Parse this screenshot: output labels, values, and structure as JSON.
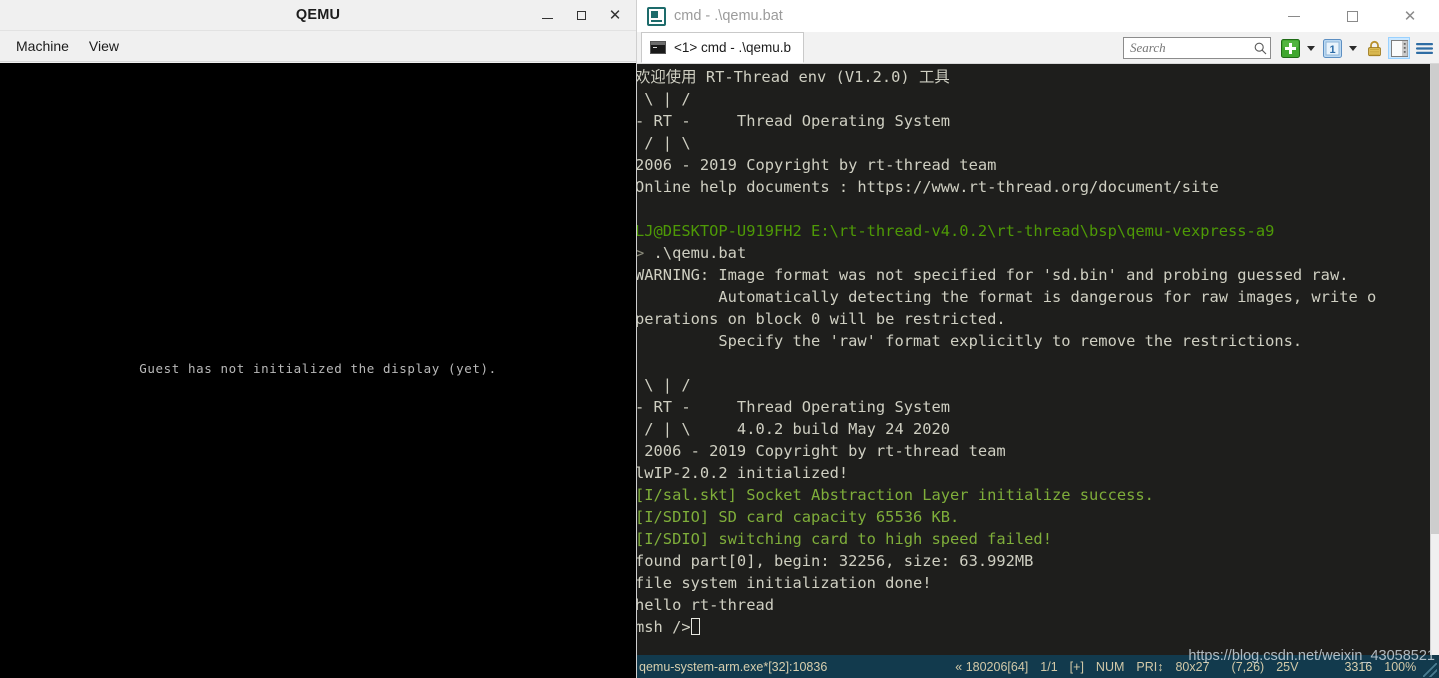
{
  "qemu": {
    "title": "QEMU",
    "window_buttons": [
      {
        "name": "minimize",
        "label": "–"
      },
      {
        "name": "maximize",
        "label": "□"
      },
      {
        "name": "close",
        "label": "✕"
      }
    ],
    "menu": [
      {
        "label": "Machine"
      },
      {
        "label": "View"
      }
    ],
    "guest_message": "Guest has not initialized the display (yet)."
  },
  "console": {
    "title": "cmd - .\\qemu.bat",
    "app_icon": "conemu-icon",
    "tab": {
      "label": "<1> cmd - .\\qemu.b",
      "icon": "console-window-icon"
    },
    "window_buttons": [
      {
        "name": "minimize",
        "label": "–"
      },
      {
        "name": "maximize",
        "label": "□"
      },
      {
        "name": "close",
        "label": "✕"
      }
    ],
    "search": {
      "placeholder": "Search",
      "value": "",
      "icon": "search-icon"
    },
    "toolbar": [
      {
        "name": "new-console-button",
        "icon": "green-plus-icon"
      },
      {
        "name": "new-console-dropdown",
        "icon": "chevron-down-icon"
      },
      {
        "name": "active-console-button",
        "icon": "blue-one-icon"
      },
      {
        "name": "active-console-dropdown",
        "icon": "chevron-down-icon"
      },
      {
        "name": "lock-button",
        "icon": "padlock-icon"
      },
      {
        "name": "toggle-panel-button",
        "icon": "split-panel-icon"
      },
      {
        "name": "menu-button",
        "icon": "hamburger-menu-icon"
      }
    ],
    "terminal": {
      "lines": [
        {
          "segments": [
            {
              "text": "欢迎使用 RT-Thread env (V1.2.0) 工具",
              "color": "gray"
            }
          ]
        },
        {
          "segments": [
            {
              "text": " \\ | /",
              "color": "gray"
            }
          ]
        },
        {
          "segments": [
            {
              "text": "- RT -     Thread Operating System",
              "color": "gray"
            }
          ]
        },
        {
          "segments": [
            {
              "text": " / | \\",
              "color": "gray"
            }
          ]
        },
        {
          "segments": [
            {
              "text": "2006 - 2019 Copyright by rt-thread team",
              "color": "gray"
            }
          ]
        },
        {
          "segments": [
            {
              "text": "Online help documents : https://www.rt-thread.org/document/site",
              "color": "gray"
            }
          ]
        },
        {
          "segments": [
            {
              "text": "",
              "color": "gray"
            }
          ]
        },
        {
          "segments": [
            {
              "text": "LJ@DESKTOP-U919FH2 E:\\rt-thread-v4.0.2\\rt-thread\\bsp\\qemu-vexpress-a9",
              "color": "green"
            }
          ]
        },
        {
          "segments": [
            {
              "text": "> ",
              "color": "dim"
            },
            {
              "text": ".\\qemu.bat",
              "color": "gray"
            }
          ]
        },
        {
          "segments": [
            {
              "text": "WARNING: Image format was not specified for 'sd.bin' and probing guessed raw.",
              "color": "gray"
            }
          ]
        },
        {
          "segments": [
            {
              "text": "         Automatically detecting the format is dangerous for raw images, write o",
              "color": "gray"
            }
          ]
        },
        {
          "segments": [
            {
              "text": "perations on block 0 will be restricted.",
              "color": "gray"
            }
          ]
        },
        {
          "segments": [
            {
              "text": "         Specify the 'raw' format explicitly to remove the restrictions.",
              "color": "gray"
            }
          ]
        },
        {
          "segments": [
            {
              "text": "",
              "color": "gray"
            }
          ]
        },
        {
          "segments": [
            {
              "text": " \\ | /",
              "color": "gray"
            }
          ]
        },
        {
          "segments": [
            {
              "text": "- RT -     Thread Operating System",
              "color": "gray"
            }
          ]
        },
        {
          "segments": [
            {
              "text": " / | \\     4.0.2 build May 24 2020",
              "color": "gray"
            }
          ]
        },
        {
          "segments": [
            {
              "text": " 2006 - 2019 Copyright by rt-thread team",
              "color": "gray"
            }
          ]
        },
        {
          "segments": [
            {
              "text": "lwIP-2.0.2 initialized!",
              "color": "gray"
            }
          ]
        },
        {
          "segments": [
            {
              "text": "[I/sal.skt] Socket Abstraction Layer initialize success.",
              "color": "lgreen"
            }
          ]
        },
        {
          "segments": [
            {
              "text": "[I/SDIO] SD card capacity 65536 KB.",
              "color": "lgreen"
            }
          ]
        },
        {
          "segments": [
            {
              "text": "[I/SDIO] switching card to high speed failed!",
              "color": "lgreen"
            }
          ]
        },
        {
          "segments": [
            {
              "text": "found part[0], begin: 32256, size: 63.992MB",
              "color": "gray"
            }
          ]
        },
        {
          "segments": [
            {
              "text": "file system initialization done!",
              "color": "gray"
            }
          ]
        },
        {
          "segments": [
            {
              "text": "hello rt-thread",
              "color": "gray"
            }
          ]
        },
        {
          "segments": [
            {
              "text": "msh />",
              "color": "gray"
            },
            {
              "cursor": true
            }
          ]
        }
      ]
    },
    "statusbar": {
      "process": "qemu-system-arm.exe*[32]:10836",
      "buffer": "« 180206[64]",
      "tabs": "1/1",
      "insert_mode": "[+]",
      "num_lock": "NUM",
      "priority": "PRI↕",
      "size": "80x27",
      "cursor_pos": "(7,26)",
      "color_depth": "25V",
      "memory": "3316",
      "zoom": "100%"
    }
  },
  "watermark": "https://blog.csdn.net/weixin_43058521"
}
